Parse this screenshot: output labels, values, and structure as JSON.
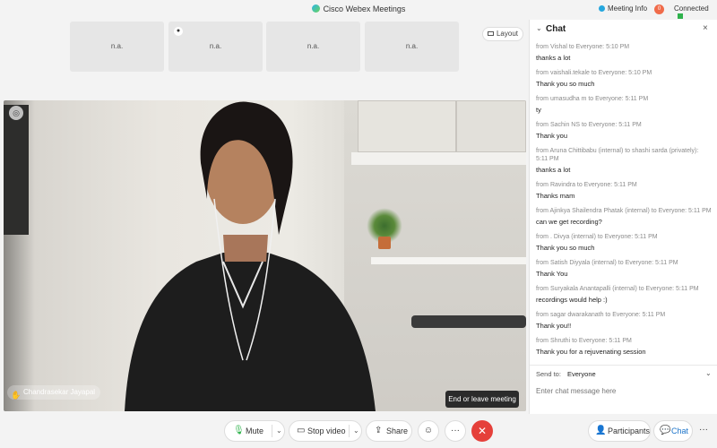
{
  "titlebar": {
    "app_title": "Cisco Webex Meetings",
    "meeting_info": "Meeting Info",
    "recording_indicator": "0",
    "connection_status": "Connected"
  },
  "thumbnails": [
    {
      "label": "n.a."
    },
    {
      "label": "n.a."
    },
    {
      "label": "n.a."
    },
    {
      "label": "n.a."
    }
  ],
  "layout_button": "Layout",
  "active_speaker": {
    "name": "Chandrasekar Jayapal"
  },
  "tooltip": "End or leave meeting",
  "toolbar": {
    "mute": "Mute",
    "stop_video": "Stop video",
    "share": "Share",
    "participants": "Participants",
    "chat": "Chat"
  },
  "chat": {
    "title": "Chat",
    "send_to_label": "Send to:",
    "send_to_value": "Everyone",
    "input_placeholder": "Enter chat message here",
    "messages": [
      {
        "meta": "from Vishal to Everyone:   5:10  PM",
        "text": "thanks a lot"
      },
      {
        "meta": "from vaishali.tekale to Everyone:   5:10  PM",
        "text": "Thank you so much"
      },
      {
        "meta": "from umasudha m to Everyone:   5:11  PM",
        "text": "ty"
      },
      {
        "meta": "from Sachin NS to Everyone:   5:11  PM",
        "text": "Thank you"
      },
      {
        "meta": "from Aruna Chittibabu (internal) to shashi sarda (privately):  5:11  PM",
        "text": "thanks a lot"
      },
      {
        "meta": "from Ravindra to Everyone:   5:11  PM",
        "text": "Thanks mam"
      },
      {
        "meta": "from Ajinkya Shailendra Phatak (internal) to Everyone:   5:11  PM",
        "text": "can we get recording?"
      },
      {
        "meta": "from . Divya (internal) to Everyone:   5:11  PM",
        "text": "Thank you so much"
      },
      {
        "meta": "from Satish Diyyala (internal) to Everyone:   5:11  PM",
        "text": "Thank  You"
      },
      {
        "meta": "from Suryakala Anantapalli (internal) to Everyone:   5:11  PM",
        "text": "recordings would help :)"
      },
      {
        "meta": "from sagar dwarakanath to Everyone:   5:11  PM",
        "text": "Thank you!!"
      },
      {
        "meta": "from Shruthi to Everyone:   5:11  PM",
        "text": "Thank you for a rejuvenating session"
      }
    ]
  },
  "colors": {
    "end_button": "#e5403a",
    "connected_indicator": "#2fb24c",
    "chat_background": "#ffffff"
  }
}
